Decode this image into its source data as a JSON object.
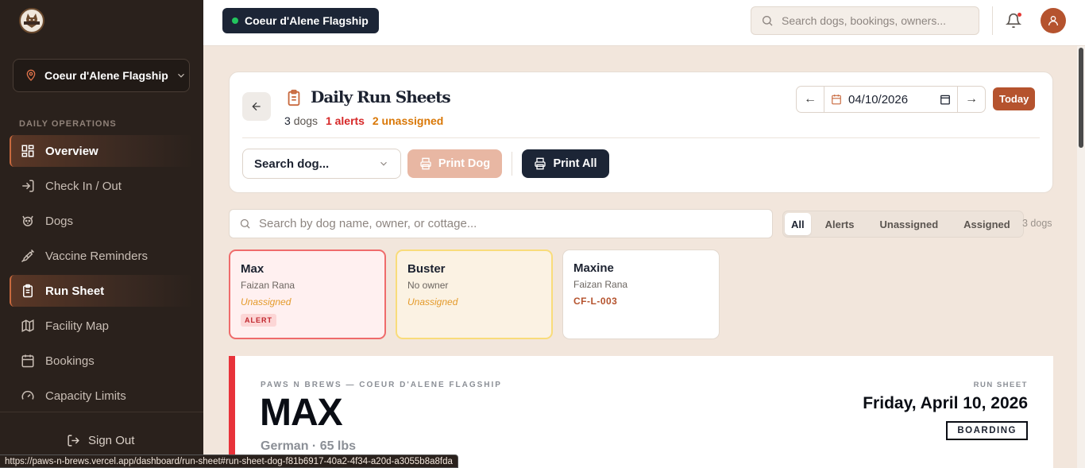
{
  "sidebar": {
    "location": "Coeur d'Alene Flagship",
    "section_label": "DAILY OPERATIONS",
    "items": [
      {
        "label": "Overview",
        "icon": "grid-icon",
        "active": true
      },
      {
        "label": "Check In / Out",
        "icon": "log-in-icon"
      },
      {
        "label": "Dogs",
        "icon": "dog-icon"
      },
      {
        "label": "Vaccine Reminders",
        "icon": "syringe-icon"
      },
      {
        "label": "Run Sheet",
        "icon": "clipboard-icon",
        "active": true
      },
      {
        "label": "Facility Map",
        "icon": "map-icon"
      },
      {
        "label": "Bookings",
        "icon": "calendar-icon"
      },
      {
        "label": "Capacity Limits",
        "icon": "gauge-icon"
      }
    ],
    "signout": "Sign Out"
  },
  "topbar": {
    "location": "Coeur d'Alene Flagship",
    "search_placeholder": "Search dogs, bookings, owners..."
  },
  "header": {
    "title": "Daily Run Sheets",
    "count": "3",
    "count_label": "dogs",
    "alerts": "1 alerts",
    "unassigned": "2 unassigned",
    "date": "04/10/2026",
    "today": "Today",
    "dog_select": "Search dog...",
    "print_dog": "Print Dog",
    "print_all": "Print All"
  },
  "filter": {
    "search_placeholder": "Search by dog name, owner, or cottage...",
    "tabs": [
      "All",
      "Alerts",
      "Unassigned",
      "Assigned"
    ],
    "count": "3 dogs"
  },
  "dogs": [
    {
      "name": "Max",
      "owner": "Faizan Rana",
      "status": "Unassigned",
      "badge": "ALERT"
    },
    {
      "name": "Buster",
      "owner": "No owner",
      "status": "Unassigned"
    },
    {
      "name": "Maxine",
      "owner": "Faizan Rana",
      "cottage": "CF-L-003"
    }
  ],
  "sheet": {
    "brand": "PAWS N BREWS — COEUR D'ALENE FLAGSHIP",
    "dog_name": "MAX",
    "breed": "German · 65 lbs",
    "label": "RUN SHEET",
    "date": "Friday, April 10, 2026",
    "type": "BOARDING"
  },
  "status_url": "https://paws-n-brews.vercel.app/dashboard/run-sheet#run-sheet-dog-f81b6917-40a2-4f34-a20d-a3055b8a8fda",
  "colors": {
    "accent": "#b5532e",
    "dark": "#1c2536",
    "sidebar": "#2a211c",
    "alert": "#d62828",
    "warning": "#d97706"
  }
}
